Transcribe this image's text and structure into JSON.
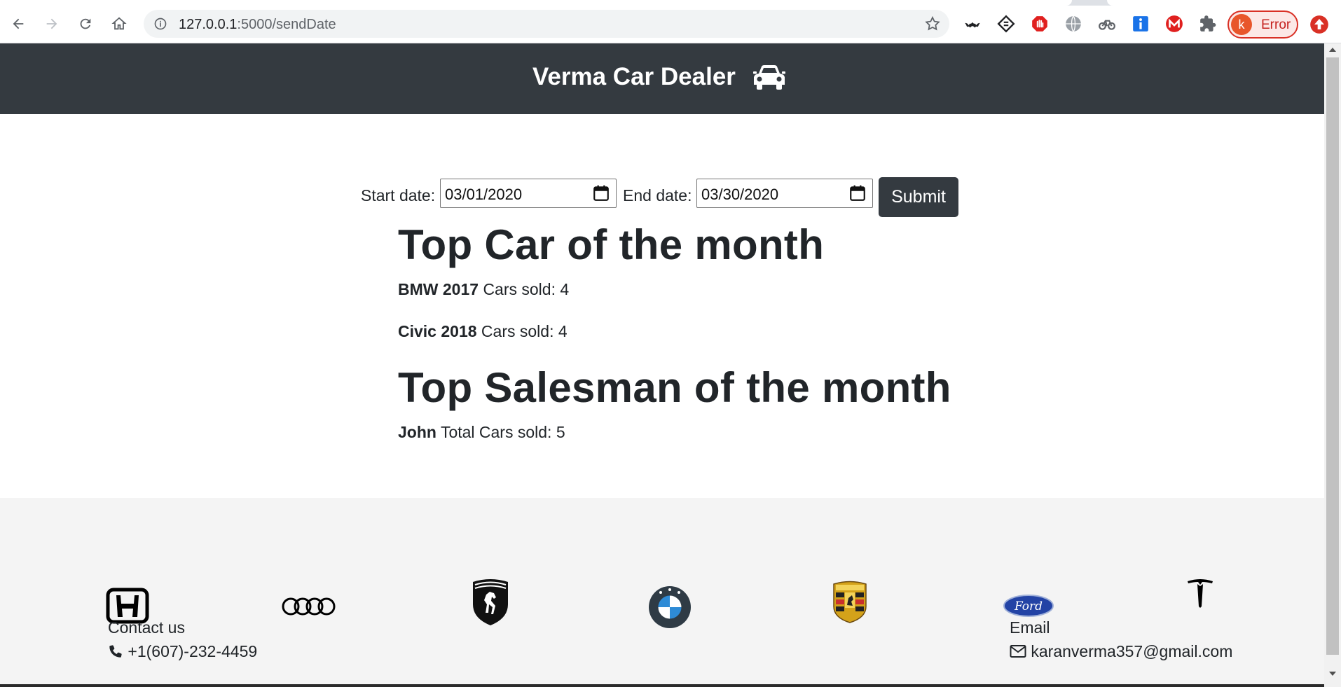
{
  "browser": {
    "url_host": "127.0.0.1",
    "url_path": ":5000/sendDate",
    "profile_initial": "k",
    "profile_status": "Error"
  },
  "navbar": {
    "brand": "Verma Car Dealer",
    "brand_icon": "car-icon"
  },
  "form": {
    "start_label": "Start date:",
    "start_value": "03/01/2020",
    "end_label": "End date:",
    "end_value": "03/30/2020",
    "submit_label": "Submit"
  },
  "top_cars": {
    "heading": "Top Car of the month",
    "items": [
      {
        "name": "BMW 2017",
        "detail": "Cars sold: 4"
      },
      {
        "name": "Civic 2018",
        "detail": "Cars sold: 4"
      }
    ]
  },
  "top_salesman": {
    "heading": "Top Salesman of the month",
    "items": [
      {
        "name": "John",
        "detail": "Total Cars sold: 5"
      }
    ]
  },
  "footer": {
    "brand_logos": [
      "honda-logo",
      "audi-logo",
      "ferrari-logo",
      "bmw-logo",
      "porsche-logo",
      "ford-logo",
      "tesla-logo"
    ],
    "ford_text": "Ford",
    "contact_heading": "Contact us",
    "phone": "+1(607)-232-4459",
    "email_heading": "Email",
    "email": "karanverma357@gmail.com"
  },
  "colors": {
    "navbar_bg": "#343a40",
    "footer_bg": "#f4f4f4",
    "text": "#212529"
  }
}
